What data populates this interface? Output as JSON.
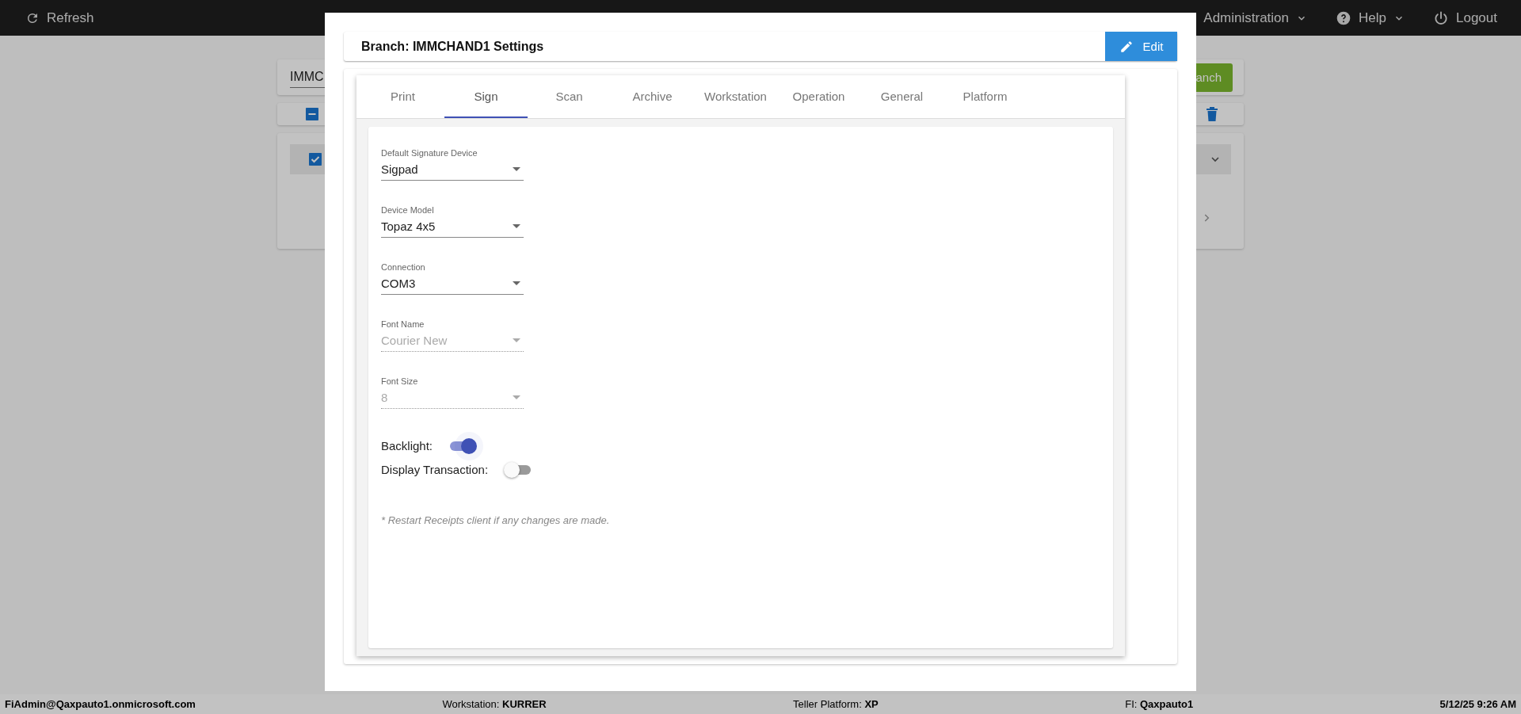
{
  "top_bar": {
    "refresh": "Refresh",
    "menus": [
      {
        "kind": "menu",
        "label": "Administration"
      },
      {
        "kind": "help",
        "label": "Help"
      },
      {
        "kind": "logout",
        "label": "Logout"
      }
    ]
  },
  "background": {
    "search_value": "IMMC",
    "search_button": "anch",
    "select_all_partial": true,
    "items": [
      {
        "checked": true,
        "expanded": false
      }
    ]
  },
  "modal": {
    "title": "Branch: IMMCHAND1 Settings",
    "edit_button": "Edit",
    "tabs": [
      {
        "label": "Print",
        "selected": false
      },
      {
        "label": "Sign",
        "selected": true
      },
      {
        "label": "Scan",
        "selected": false
      },
      {
        "label": "Archive",
        "selected": false
      },
      {
        "label": "Workstation",
        "selected": false
      },
      {
        "label": "Operation",
        "selected": false
      },
      {
        "label": "General",
        "selected": false
      },
      {
        "label": "Platform",
        "selected": false
      }
    ],
    "fields": [
      {
        "label": "Default Signature Device",
        "value": "Sigpad",
        "disabled": false
      },
      {
        "label": "Device Model",
        "value": "Topaz 4x5",
        "disabled": false
      },
      {
        "label": "Connection",
        "value": "COM3",
        "disabled": false
      },
      {
        "label": "Font Name",
        "value": "Courier New",
        "disabled": true
      },
      {
        "label": "Font Size",
        "value": "8",
        "disabled": true
      }
    ],
    "toggles": [
      {
        "label": "Backlight:",
        "on": true
      },
      {
        "label": "Display Transaction:",
        "on": false
      }
    ],
    "note": "* Restart Receipts client if any changes are made."
  },
  "status_bar": {
    "user": "FiAdmin@Qaxpauto1.onmicrosoft.com",
    "workstation": "Workstation: **KURRER**",
    "platform": "Teller Platform: **XP**",
    "fi": "FI: **Qaxpauto1**",
    "datetime": "5/12/25 9:26 AM"
  }
}
